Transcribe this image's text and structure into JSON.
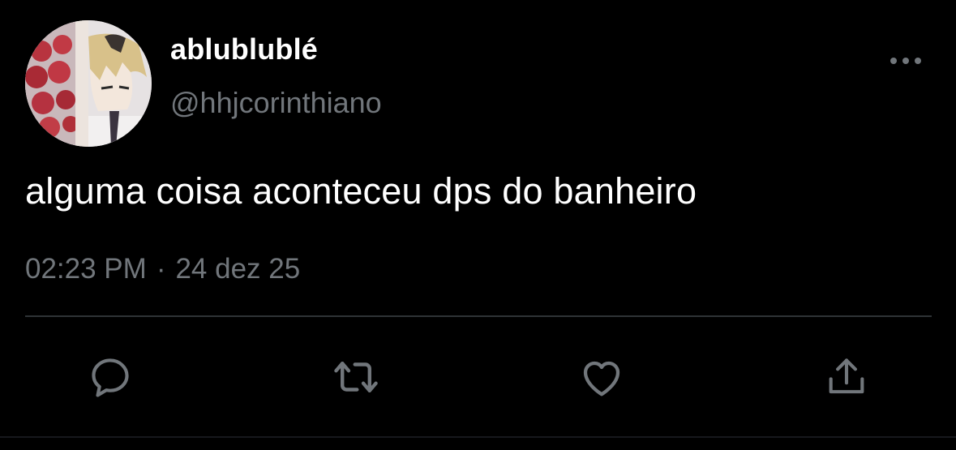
{
  "tweet": {
    "display_name": "ablublublé",
    "handle": "@hhjcorinthiano",
    "text": "alguma coisa aconteceu dps do banheiro",
    "time": "02:23 PM",
    "separator": "·",
    "date": "24 dez 25"
  },
  "icons": {
    "avatar": "avatar-image",
    "more": "more-options-icon",
    "reply": "reply-icon",
    "retweet": "retweet-icon",
    "like": "like-icon",
    "share": "share-icon"
  },
  "colors": {
    "background": "#000000",
    "text_primary": "#ffffff",
    "text_secondary": "#71767b",
    "divider": "#2f3336"
  }
}
